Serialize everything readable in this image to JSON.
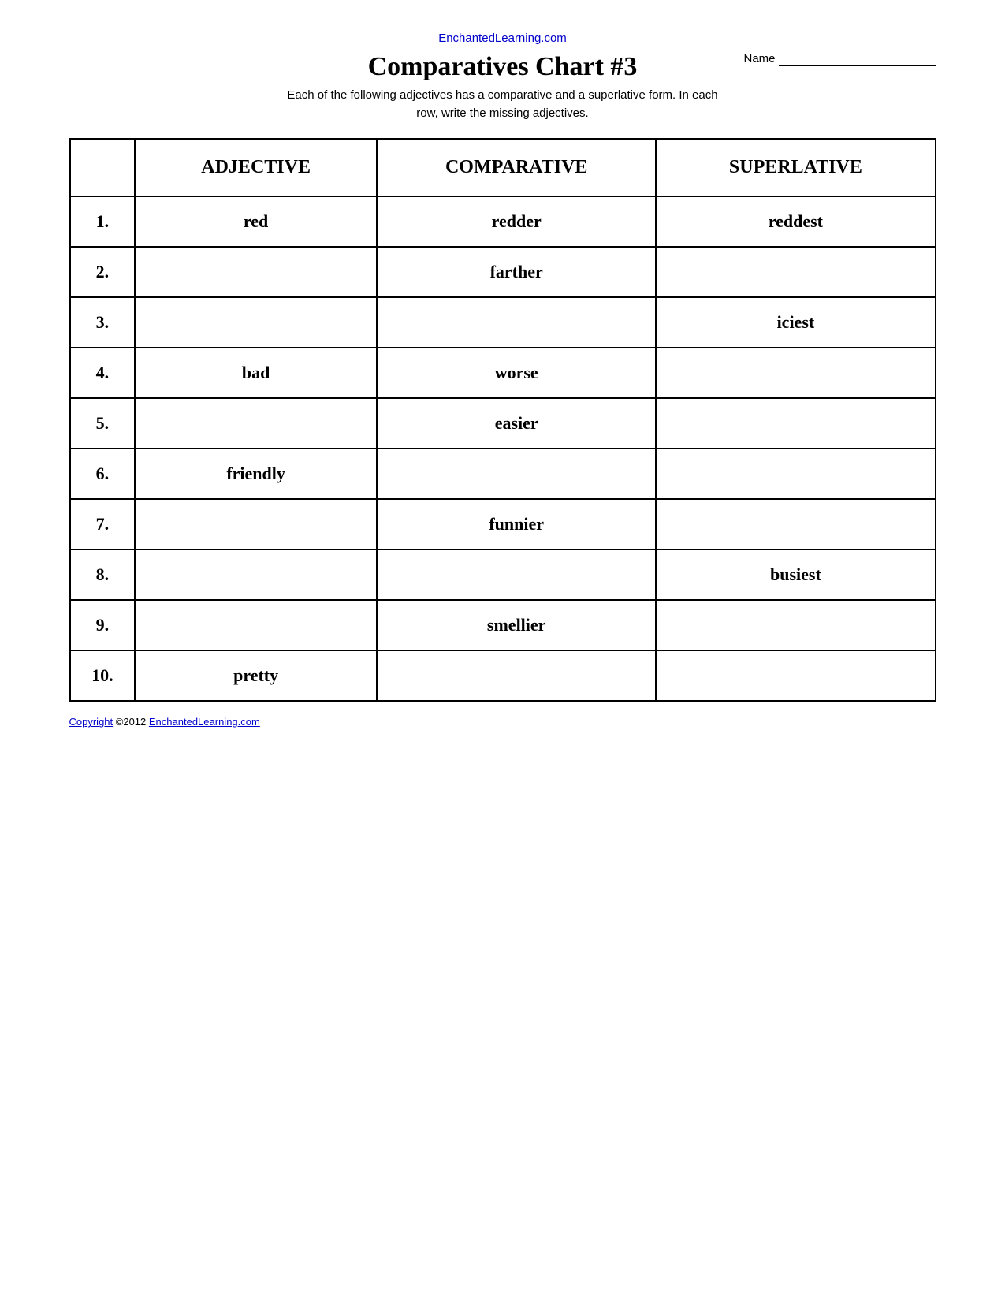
{
  "header": {
    "site_link": "EnchantedLearning.com",
    "site_url": "EnchantedLearning.com",
    "title": "Comparatives Chart #3",
    "name_label": "Name",
    "subtitle_line1": "Each of the following adjectives has a comparative and a superlative form. In each",
    "subtitle_line2": "row, write the missing adjectives."
  },
  "table": {
    "col_adjective": "ADJECTIVE",
    "col_comparative": "COMPARATIVE",
    "col_superlative": "SUPERLATIVE",
    "rows": [
      {
        "num": "1.",
        "adjective": "red",
        "comparative": "redder",
        "superlative": "reddest"
      },
      {
        "num": "2.",
        "adjective": "",
        "comparative": "farther",
        "superlative": ""
      },
      {
        "num": "3.",
        "adjective": "",
        "comparative": "",
        "superlative": "iciest"
      },
      {
        "num": "4.",
        "adjective": "bad",
        "comparative": "worse",
        "superlative": ""
      },
      {
        "num": "5.",
        "adjective": "",
        "comparative": "easier",
        "superlative": ""
      },
      {
        "num": "6.",
        "adjective": "friendly",
        "comparative": "",
        "superlative": ""
      },
      {
        "num": "7.",
        "adjective": "",
        "comparative": "funnier",
        "superlative": ""
      },
      {
        "num": "8.",
        "adjective": "",
        "comparative": "",
        "superlative": "busiest"
      },
      {
        "num": "9.",
        "adjective": "",
        "comparative": "smellier",
        "superlative": ""
      },
      {
        "num": "10.",
        "adjective": "pretty",
        "comparative": "",
        "superlative": ""
      }
    ]
  },
  "footer": {
    "copyright_text": "Copyright",
    "year": "©2012 ",
    "footer_link": "EnchantedLearning.com"
  }
}
